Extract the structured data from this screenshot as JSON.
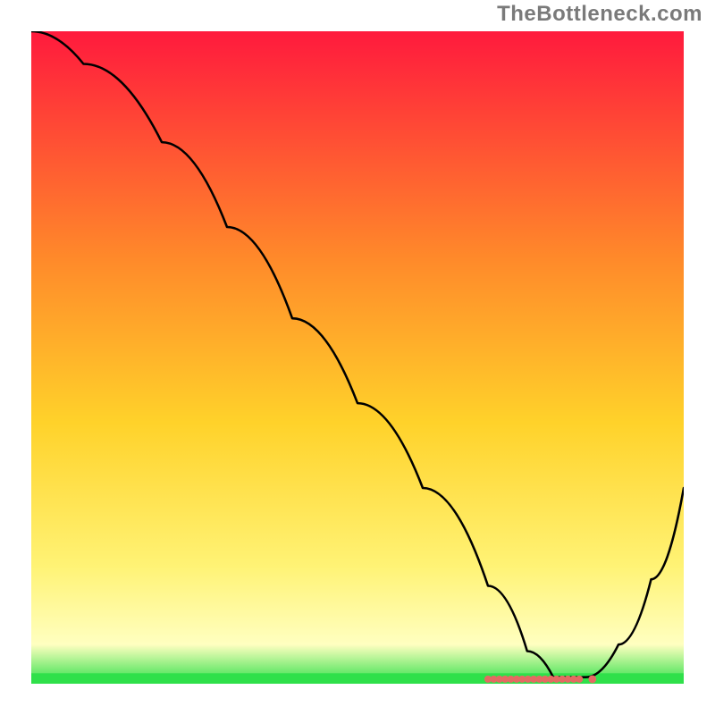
{
  "watermark": "TheBottleneck.com",
  "chart_data": {
    "type": "line",
    "title": "",
    "xlabel": "",
    "ylabel": "",
    "xlim": [
      0,
      100
    ],
    "ylim": [
      0,
      100
    ],
    "grid": false,
    "gradient_colors": {
      "top": "#ff1a3d",
      "upper_mid": "#ff8a2a",
      "mid": "#ffd22a",
      "lower_mid": "#fff375",
      "near_bottom": "#ffffc0",
      "bottom": "#2fe04a"
    },
    "series": [
      {
        "name": "bottleneck-curve",
        "x": [
          0,
          8,
          20,
          30,
          40,
          50,
          60,
          70,
          76,
          80,
          85,
          90,
          95,
          100
        ],
        "y": [
          100,
          95,
          83,
          70,
          56,
          43,
          30,
          15,
          5,
          1,
          1,
          6,
          16,
          30
        ]
      }
    ],
    "markers": {
      "name": "highlight-range",
      "color": "#e46a62",
      "x_range": [
        70,
        84
      ],
      "y": 0.7
    }
  }
}
